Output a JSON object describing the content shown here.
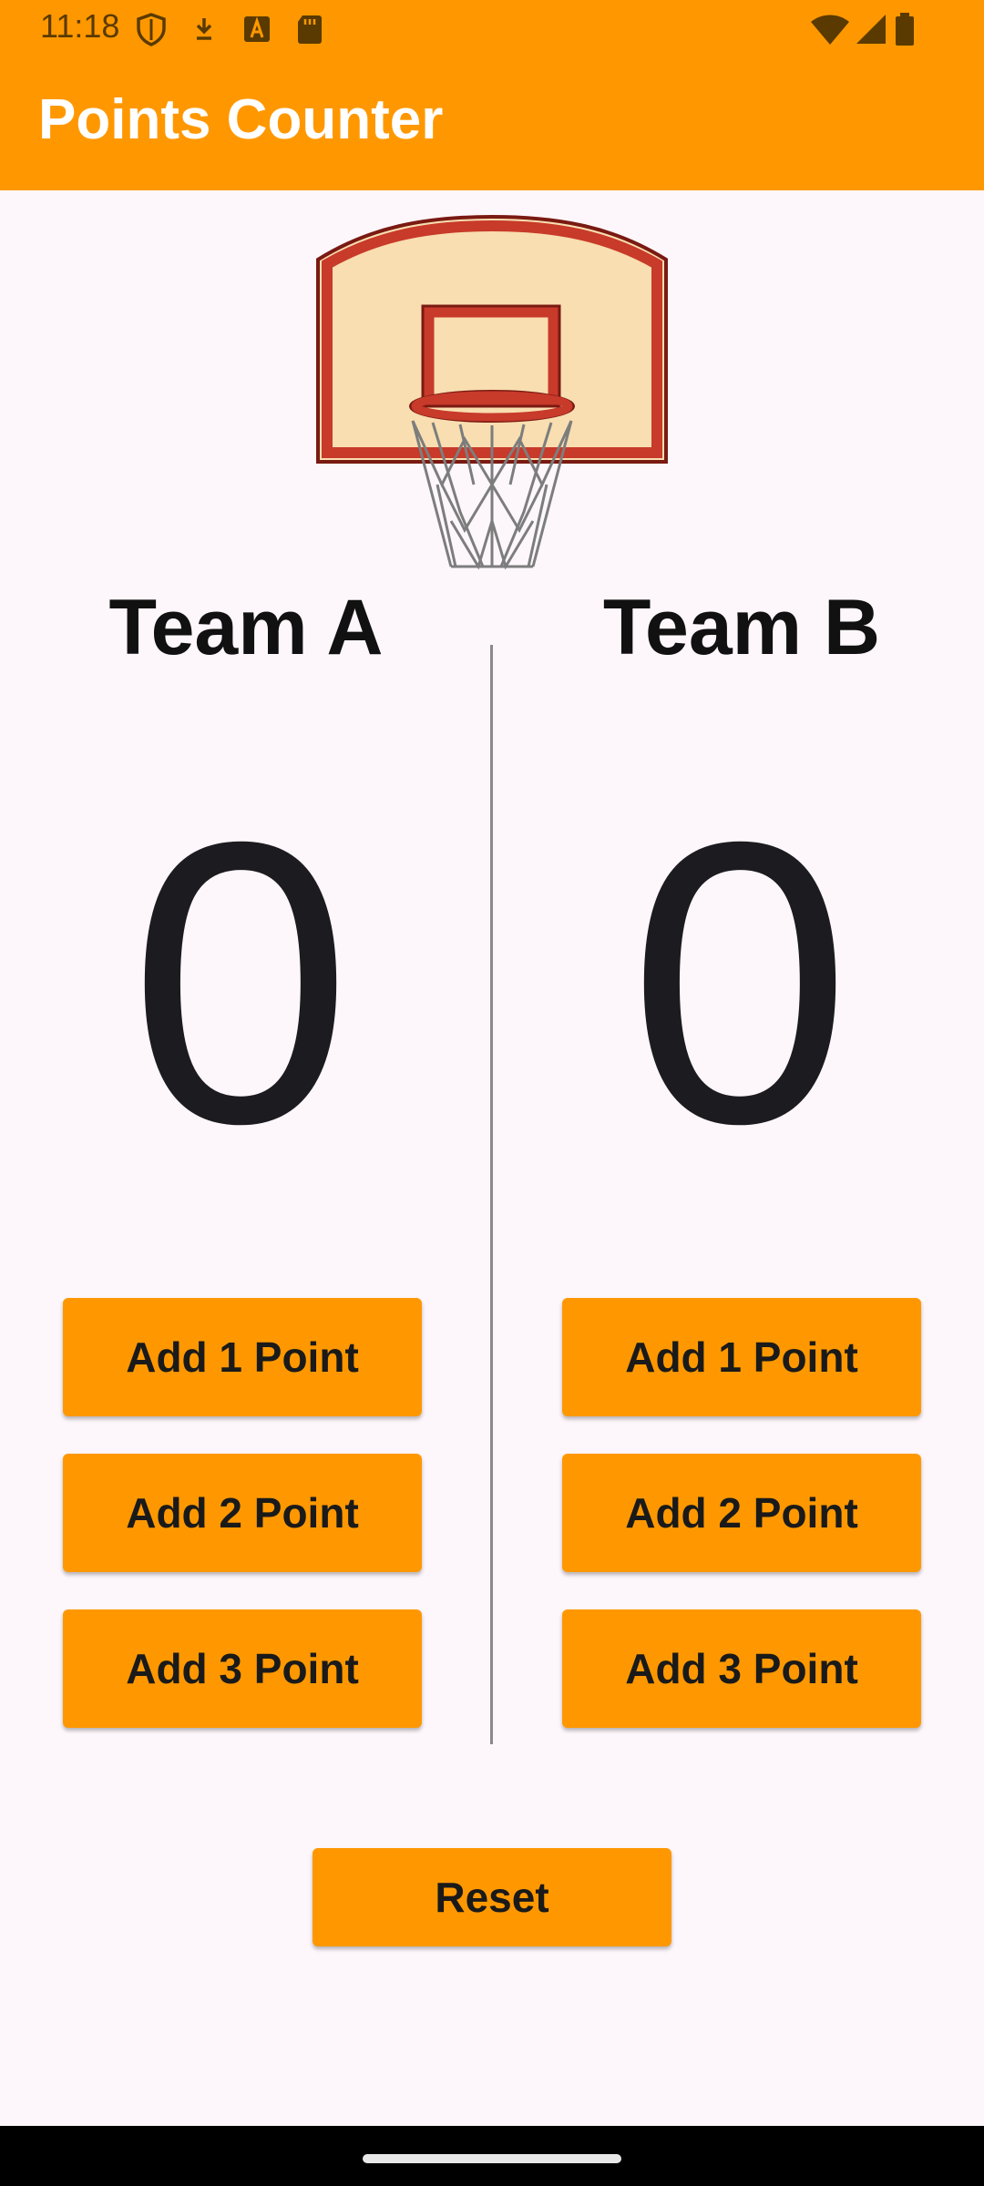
{
  "status_bar": {
    "time": "11:18",
    "left_icons": [
      "shield-icon",
      "download-icon",
      "font-icon",
      "sd-card-icon"
    ],
    "right_icons": [
      "wifi-icon",
      "signal-icon",
      "battery-icon"
    ]
  },
  "app_bar": {
    "title": "Points Counter",
    "color": "#ff9800"
  },
  "hero": {
    "icon": "basketball-hoop-icon"
  },
  "team_a": {
    "name": "Team A",
    "score": "0",
    "buttons": [
      "Add 1 Point",
      "Add 2 Point",
      "Add 3 Point"
    ]
  },
  "team_b": {
    "name": "Team B",
    "score": "0",
    "buttons": [
      "Add 1 Point",
      "Add 2 Point",
      "Add 3 Point"
    ]
  },
  "reset": {
    "label": "Reset"
  },
  "accent_color": "#ff9800"
}
